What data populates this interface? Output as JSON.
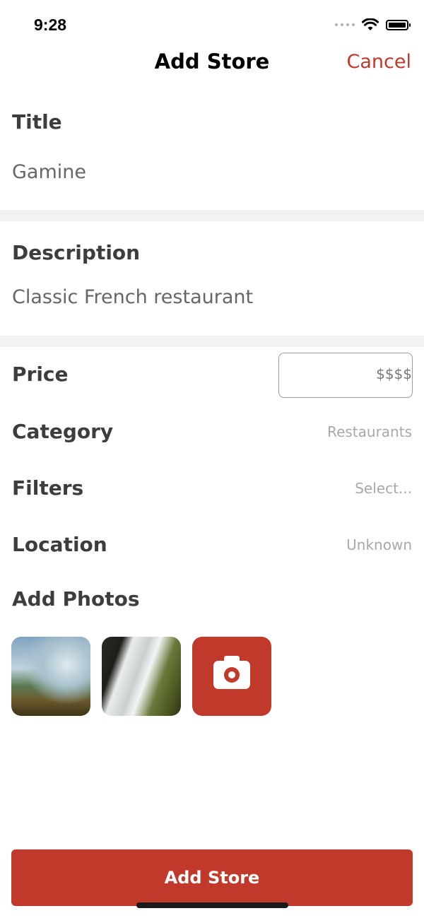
{
  "status_bar": {
    "time": "9:28"
  },
  "nav": {
    "title": "Add Store",
    "cancel_label": "Cancel"
  },
  "form": {
    "title": {
      "label": "Title",
      "value": "Gamine"
    },
    "description": {
      "label": "Description",
      "value": "Classic French restaurant"
    },
    "price": {
      "label": "Price",
      "value": "$$$$"
    },
    "category": {
      "label": "Category",
      "value": "Restaurants"
    },
    "filters": {
      "label": "Filters",
      "value": "Select..."
    },
    "location": {
      "label": "Location",
      "value": "Unknown"
    },
    "photos": {
      "label": "Add Photos"
    }
  },
  "submit": {
    "label": "Add Store"
  },
  "colors": {
    "accent": "#c0392b",
    "label": "#3d3d3d",
    "divider": "#f2f2f2"
  }
}
